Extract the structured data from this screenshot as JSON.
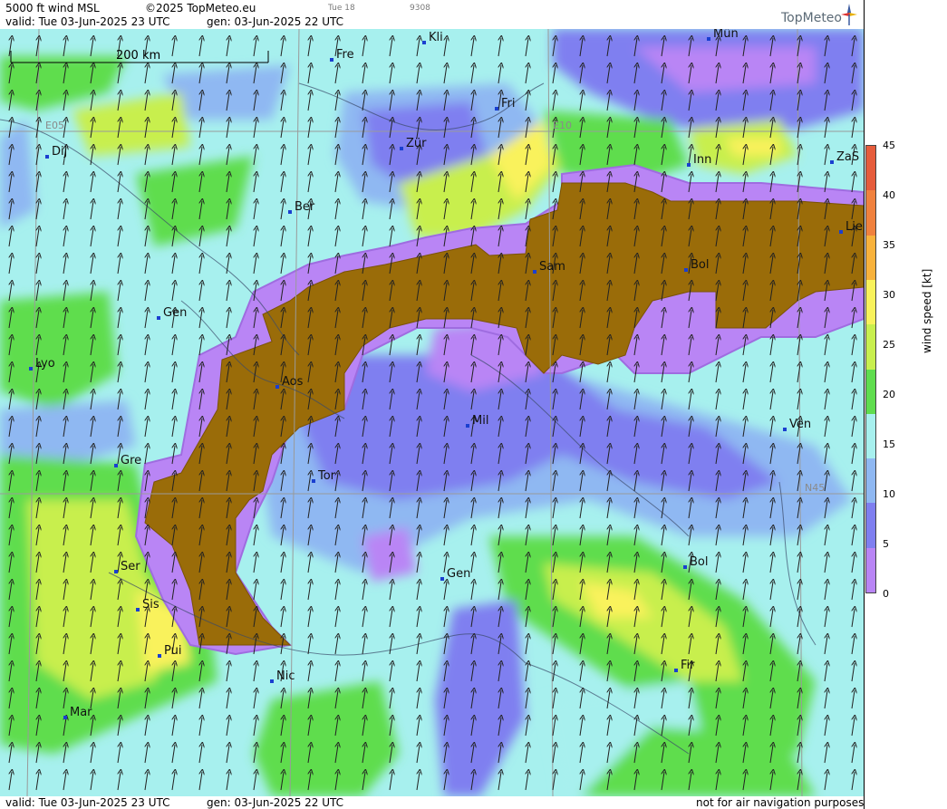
{
  "header": {
    "product": "5000 ft wind MSL",
    "copyright": "©2025 TopMeteo.eu",
    "daylabel": "Tue 18",
    "code": "9308",
    "valid": "valid:  Tue  03-Jun-2025  23 UTC",
    "gen": "gen: 03-Jun-2025 22 UTC",
    "logo": "TopMeteo"
  },
  "footer": {
    "valid": "valid:  Tue  03-Jun-2025  23 UTC",
    "gen": "gen: 03-Jun-2025 22 UTC",
    "disclaimer": "not for air navigation purposes"
  },
  "scale_label": "200 km",
  "grid_labels": {
    "e05": "E05",
    "e10": "E10",
    "n45": "N45"
  },
  "colorbar": {
    "label": "wind speed [kt]",
    "ticks": [
      "45",
      "40",
      "35",
      "30",
      "25",
      "20",
      "15",
      "10",
      "5",
      "0"
    ],
    "colors": [
      "#e65c3c",
      "#f0813e",
      "#f8b23c",
      "#f9f25b",
      "#c8ef4e",
      "#5fdd4e",
      "#a7f0ee",
      "#8fb8f2",
      "#7f7ff0",
      "#b985f5"
    ]
  },
  "cities": [
    {
      "id": "kli",
      "label": "Kli"
    },
    {
      "id": "mun",
      "label": "Mün"
    },
    {
      "id": "fre",
      "label": "Fre"
    },
    {
      "id": "fri",
      "label": "Fri"
    },
    {
      "id": "dij",
      "label": "Dij"
    },
    {
      "id": "zur",
      "label": "Zür"
    },
    {
      "id": "inn",
      "label": "Inn"
    },
    {
      "id": "zas",
      "label": "ZaS"
    },
    {
      "id": "ber",
      "label": "Ber"
    },
    {
      "id": "lie",
      "label": "Lie"
    },
    {
      "id": "sam",
      "label": "Sam"
    },
    {
      "id": "bol1",
      "label": "Bol"
    },
    {
      "id": "gen1",
      "label": "Gen"
    },
    {
      "id": "lyo",
      "label": "Lyo"
    },
    {
      "id": "aos",
      "label": "Aos"
    },
    {
      "id": "mil",
      "label": "Mil"
    },
    {
      "id": "ven",
      "label": "Ven"
    },
    {
      "id": "gre",
      "label": "Gre"
    },
    {
      "id": "tor",
      "label": "Tor"
    },
    {
      "id": "ser",
      "label": "Ser"
    },
    {
      "id": "gen2",
      "label": "Gen"
    },
    {
      "id": "bol2",
      "label": "Bol"
    },
    {
      "id": "sis",
      "label": "Sis"
    },
    {
      "id": "pui",
      "label": "Pui"
    },
    {
      "id": "fir",
      "label": "Fir"
    },
    {
      "id": "nic",
      "label": "Nic"
    },
    {
      "id": "mar",
      "label": "Mar"
    }
  ]
}
